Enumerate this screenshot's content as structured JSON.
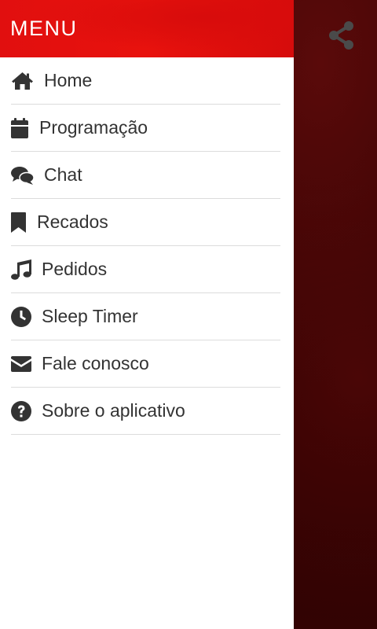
{
  "drawer": {
    "title": "MENU",
    "items": [
      {
        "label": "Home",
        "icon": "home-icon"
      },
      {
        "label": "Programação",
        "icon": "calendar-icon"
      },
      {
        "label": "Chat",
        "icon": "chat-icon"
      },
      {
        "label": "Recados",
        "icon": "bookmark-icon"
      },
      {
        "label": "Pedidos",
        "icon": "music-icon"
      },
      {
        "label": "Sleep Timer",
        "icon": "clock-icon"
      },
      {
        "label": "Fale conosco",
        "icon": "envelope-icon"
      },
      {
        "label": "Sobre o aplicativo",
        "icon": "question-icon"
      }
    ]
  },
  "share": {
    "icon": "share-icon"
  },
  "colors": {
    "header_red": "#e8120d",
    "icon_dark": "#333333",
    "background_dark_red": "#2a0202",
    "divider": "#dcdcdc"
  }
}
